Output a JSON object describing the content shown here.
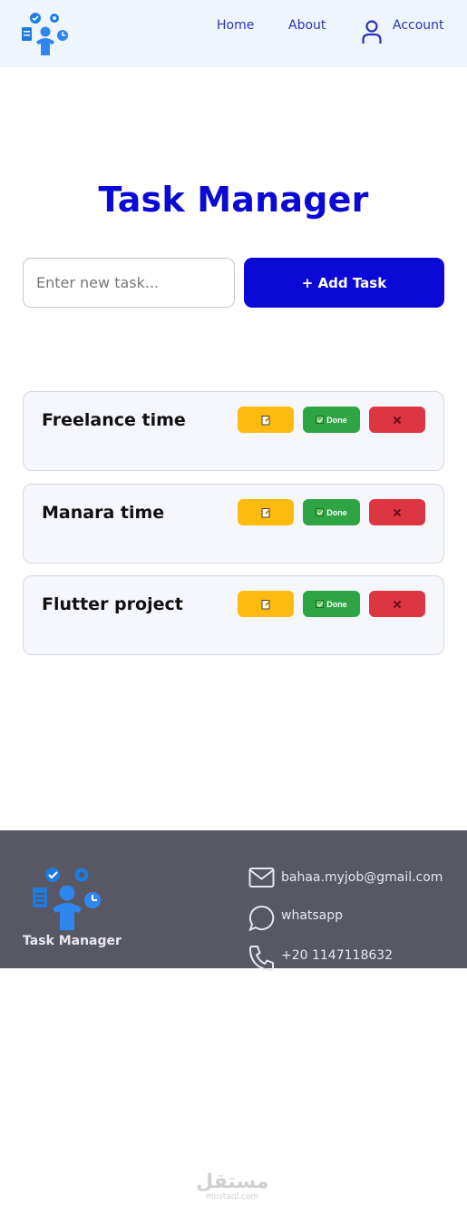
{
  "header": {
    "nav": {
      "home": "Home",
      "about": "About",
      "account": "Account"
    }
  },
  "main": {
    "title": "Task Manager",
    "input_placeholder": "Enter new task...",
    "add_button": "+ Add Task",
    "tasks": [
      {
        "text": "Freelance time",
        "done_label": "Done"
      },
      {
        "text": "Manara time",
        "done_label": "Done"
      },
      {
        "text": "Flutter project",
        "done_label": "Done"
      }
    ]
  },
  "footer": {
    "brand": "Task Manager",
    "email": "bahaa.myjob@gmail.com",
    "whatsapp": "whatsapp",
    "phone": "+20 1147118632"
  },
  "watermark": {
    "text": "مستقل",
    "sub": "mostaql.com"
  },
  "colors": {
    "primary": "#0a0ad4",
    "header_bg": "#eef5fd",
    "nav_text": "#2b33b8",
    "edit": "#fdbb0f",
    "done": "#2fa444",
    "delete": "#dd3541",
    "footer_bg": "#575864"
  },
  "icons": {
    "logo": "team-tasks-logo-icon",
    "account": "user-icon",
    "edit": "memo-icon",
    "done": "check-box-icon",
    "delete": "cross-mark-icon",
    "email": "envelope-icon",
    "whatsapp": "chat-bubble-icon",
    "phone": "phone-icon"
  }
}
